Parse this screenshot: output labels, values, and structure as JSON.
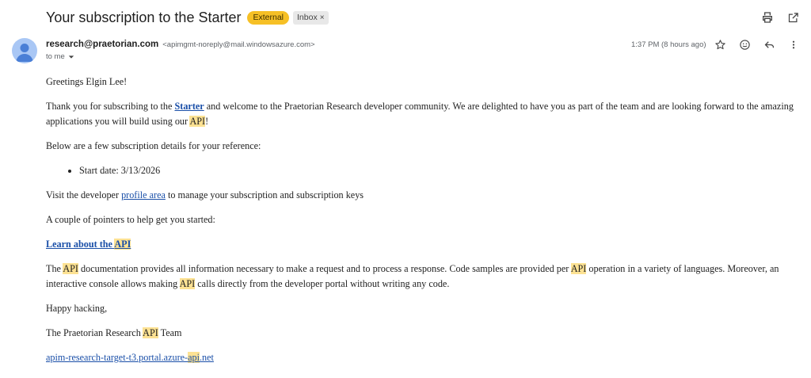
{
  "subject": {
    "title": "Your subscription to the Starter",
    "external_label": "External",
    "inbox_label": "Inbox",
    "remove_label": "×"
  },
  "toolbar": {
    "icons": [
      "print-icon",
      "open-in-new-window-icon"
    ]
  },
  "message": {
    "sender_name": "research@praetorian.com",
    "sender_email": "<apimgmt-noreply@mail.windowsazure.com>",
    "to_label": "to me",
    "time": "1:37 PM (8 hours ago)",
    "actions": [
      "star-icon",
      "emoji-icon",
      "reply-icon",
      "more-vert-icon"
    ]
  },
  "body": {
    "greeting": "Greetings Elgin Lee!",
    "p1_a": "Thank you for subscribing to the ",
    "p1_link": "Starter",
    "p1_b": " and welcome to the Praetorian Research developer community. We are delighted to have you as part of the team and are looking forward to the amazing applications you will build using our ",
    "p1_api": "API",
    "p1_c": "!",
    "p2": "Below are a few subscription details for your reference:",
    "bullet1": "Start date: 3/13/2026",
    "p3_a": "Visit the developer ",
    "p3_link": "profile area",
    "p3_b": " to manage your subscription and subscription keys",
    "p4": "A couple of pointers to help get you started:",
    "learn_a": "Learn about the ",
    "learn_api": "API",
    "p5_a": "The ",
    "p5_api1": "API",
    "p5_b": " documentation provides all information necessary to make a request and to process a response. Code samples are provided per ",
    "p5_api2": "API",
    "p5_c": " operation in a variety of languages. Moreover, an interactive console allows making ",
    "p5_api3": "API",
    "p5_d": " calls directly from the developer portal without writing any code.",
    "p6": "Happy hacking,",
    "sig_a": "The Praetorian Research ",
    "sig_api": "API",
    "sig_b": " Team",
    "url_a": "apim-research-target-t3.portal.azure-",
    "url_api": "api",
    "url_b": ".net"
  },
  "colors": {
    "highlight": "#fde293",
    "link": "#1a4fa8",
    "external_badge": "#f6c026"
  }
}
